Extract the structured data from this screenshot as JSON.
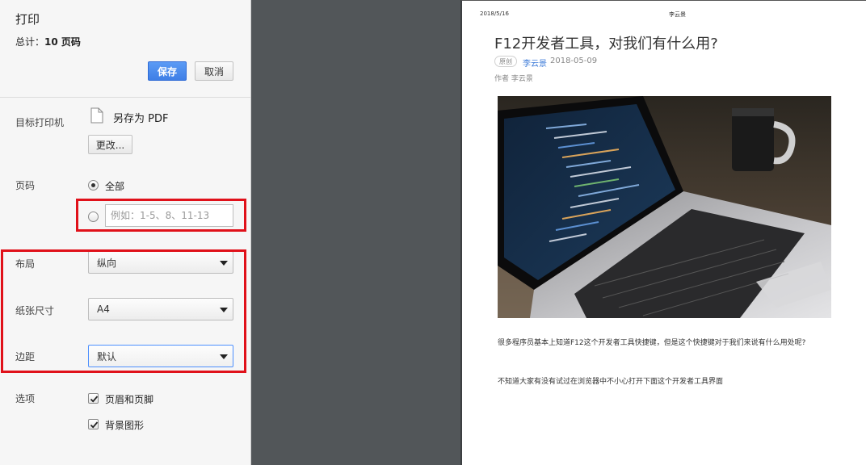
{
  "dialog": {
    "title": "打印",
    "total_prefix": "总计：",
    "total_value": "10 页码",
    "save_label": "保存",
    "cancel_label": "取消"
  },
  "destination": {
    "label": "目标打印机",
    "printer_name": "另存为 PDF",
    "change_label": "更改..."
  },
  "pages": {
    "label": "页码",
    "all_label": "全部",
    "custom_placeholder": "例如：1-5、8、11-13",
    "selected": "all"
  },
  "layout": {
    "label": "布局",
    "value": "纵向"
  },
  "paper_size": {
    "label": "纸张尺寸",
    "value": "A4"
  },
  "margins": {
    "label": "边距",
    "value": "默认"
  },
  "options": {
    "label": "选项",
    "headers_footers_label": "页眉和页脚",
    "headers_footers_checked": true,
    "background_graphics_label": "背景图形",
    "background_graphics_checked": true
  },
  "preview": {
    "header_date": "2018/5/16",
    "header_author": "李云景",
    "article_title": "F12开发者工具，对我们有什么用?",
    "tag": "原创",
    "author_link": "李云景",
    "publish_date": "2018-05-09",
    "author_line": "作者 李云景",
    "paragraph1": "很多程序员基本上知道F12这个开发者工具快捷键，但是这个快捷键对于我们来说有什么用处呢?",
    "paragraph2": "不知道大家有没有试过在浏览器中不小心打开下面这个开发者工具界面"
  },
  "colors": {
    "accent_blue": "#4a8af0",
    "highlight_red": "#e0111a",
    "preview_bg": "#525659"
  }
}
